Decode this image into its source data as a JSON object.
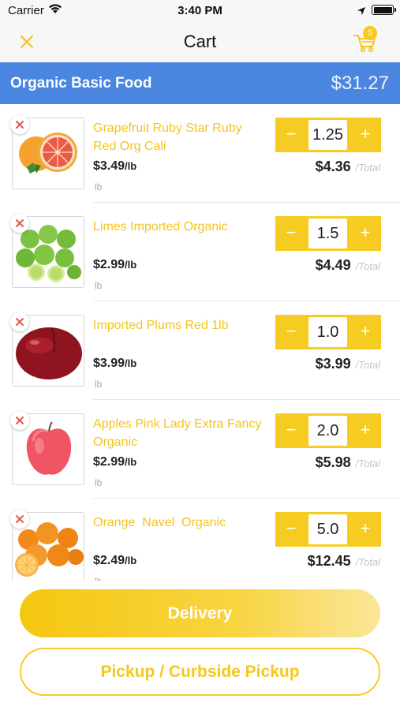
{
  "status_bar": {
    "carrier": "Carrier",
    "time": "3:40 PM"
  },
  "header": {
    "title": "Cart",
    "cart_badge": "5"
  },
  "store": {
    "name": "Organic Basic Food",
    "total": "$31.27"
  },
  "items": [
    {
      "name": "Grapefruit Ruby Star Ruby Red Org Cali",
      "price": "$3.49",
      "unit": "/lb",
      "uom": "lb",
      "quantity": "1.25",
      "line_total": "$4.36",
      "total_label": "/Total",
      "image_icon": "grapefruit-icon"
    },
    {
      "name": "Limes Imported Organic",
      "price": "$2.99",
      "unit": "/lb",
      "uom": "lb",
      "quantity": "1.5",
      "line_total": "$4.49",
      "total_label": "/Total",
      "image_icon": "limes-icon"
    },
    {
      "name": "Imported Plums Red 1lb",
      "price": "$3.99",
      "unit": "/lb",
      "uom": "lb",
      "quantity": "1.0",
      "line_total": "$3.99",
      "total_label": "/Total",
      "image_icon": "plum-icon"
    },
    {
      "name": "Apples Pink Lady Extra Fancy Organic",
      "price": "$2.99",
      "unit": "/lb",
      "uom": "lb",
      "quantity": "2.0",
      "line_total": "$5.98",
      "total_label": "/Total",
      "image_icon": "apple-icon"
    },
    {
      "name": "Orange  Navel  Organic",
      "price": "$2.49",
      "unit": "/lb",
      "uom": "lb",
      "quantity": "5.0",
      "line_total": "$12.45",
      "total_label": "/Total",
      "image_icon": "oranges-icon"
    }
  ],
  "stepper": {
    "minus": "−",
    "plus": "+"
  },
  "actions": {
    "delivery": "Delivery",
    "pickup": "Pickup / Curbside Pickup"
  },
  "colors": {
    "accent": "#f7cc22",
    "banner": "#4a86e0",
    "product_name": "#f2c51f"
  }
}
